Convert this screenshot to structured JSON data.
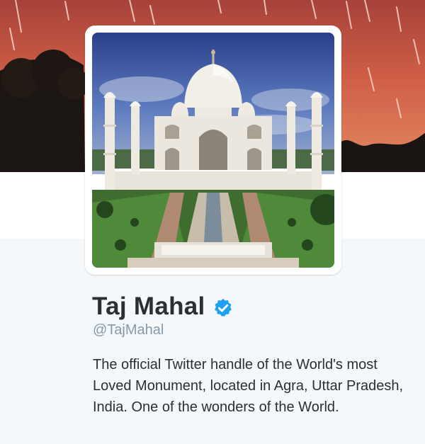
{
  "profile": {
    "name": "Taj Mahal",
    "handle": "@TajMahal",
    "bio": "The official Twitter handle of the World's most Loved Monument, located in Agra, Uttar Pradesh, India. One of the wonders of the World.",
    "verified": true
  },
  "colors": {
    "banner_sunset": "#d4644a",
    "verified_blue": "#1da1f2",
    "name_text": "#292f33",
    "handle_text": "#8899a6",
    "page_background": "#f5f8fa"
  },
  "icons": {
    "verified": "verified-badge-icon"
  }
}
